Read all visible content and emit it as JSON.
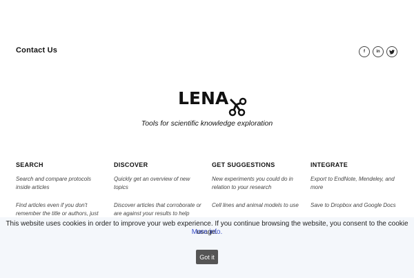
{
  "contact": {
    "title": "Contact Us"
  },
  "social": [
    {
      "icon": "facebook-icon",
      "glyph": "f"
    },
    {
      "icon": "linkedin-icon",
      "glyph": "in"
    },
    {
      "icon": "twitter-icon",
      "glyph": "❦"
    }
  ],
  "brand": {
    "logo_text": "LENA",
    "tagline": "Tools for scientific knowledge exploration"
  },
  "features": [
    {
      "heading": "SEARCH",
      "items": [
        "Search and compare protocols inside articles",
        "Find articles even if you don't remember the title or authors, just"
      ]
    },
    {
      "heading": "DISCOVER",
      "items": [
        "Quickly get an overview of new topics",
        "Discover articles that corroborate or are against your results to help"
      ]
    },
    {
      "heading": "GET SUGGESTIONS",
      "items": [
        "New experiments you could do in relation to your research",
        "Cell lines and animal models to use"
      ]
    },
    {
      "heading": "INTEGRATE",
      "items": [
        "Export to EndNote, Mendeley, and more",
        "Save to Dropbox and Google Docs"
      ]
    }
  ],
  "cookie": {
    "message": "This website uses cookies in order to improve your web experience. If you continue browsing the website, you consent to the cookie usage.",
    "more_info": "More info.",
    "button": "Got it"
  }
}
